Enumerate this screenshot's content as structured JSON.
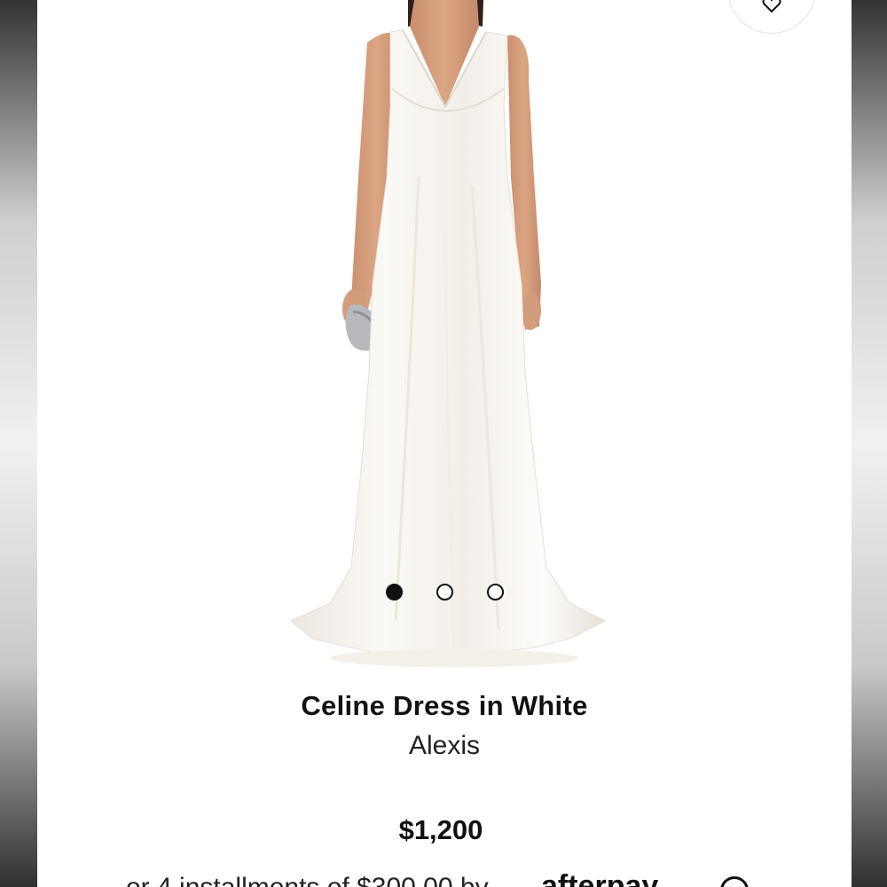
{
  "product": {
    "name": "Celine Dress in White",
    "brand": "Alexis",
    "price": "$1,200"
  },
  "gallery": {
    "image_count": 3,
    "active_index": 0
  },
  "payment": {
    "installments_text": "or 4 installments of $300.00 by",
    "provider": "afterpay"
  },
  "icons": {
    "wishlist": "heart-icon",
    "info": "info-icon",
    "provider_logo": "afterpay-logo-icon"
  },
  "colors": {
    "background": "#ffffff",
    "text": "#111111",
    "dress": "#f6f3ee"
  }
}
